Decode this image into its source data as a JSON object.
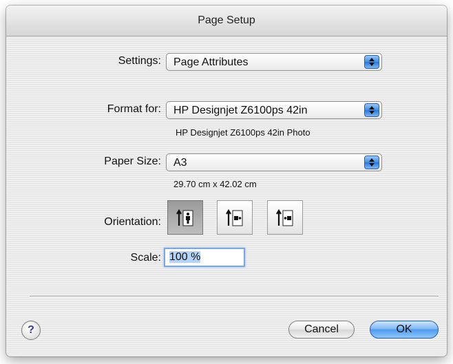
{
  "window": {
    "title": "Page Setup"
  },
  "settings": {
    "label": "Settings:",
    "value": "Page Attributes"
  },
  "format": {
    "label": "Format for:",
    "value": "HP Designjet Z6100ps 42in",
    "description": "HP Designjet Z6100ps 42in Photo"
  },
  "paper": {
    "label": "Paper Size:",
    "value": "A3",
    "dimensions": "29.70 cm x 42.02 cm"
  },
  "orientation": {
    "label": "Orientation:",
    "options": [
      "portrait",
      "landscape-left",
      "landscape-right"
    ],
    "selected": "portrait"
  },
  "scale": {
    "label": "Scale:",
    "value": "100 %"
  },
  "buttons": {
    "help": "?",
    "cancel": "Cancel",
    "ok": "OK"
  },
  "colors": {
    "default_button": "#5aa3f0",
    "stepper": "#3b8ee6",
    "selected_orientation": "#a8a8a8"
  }
}
